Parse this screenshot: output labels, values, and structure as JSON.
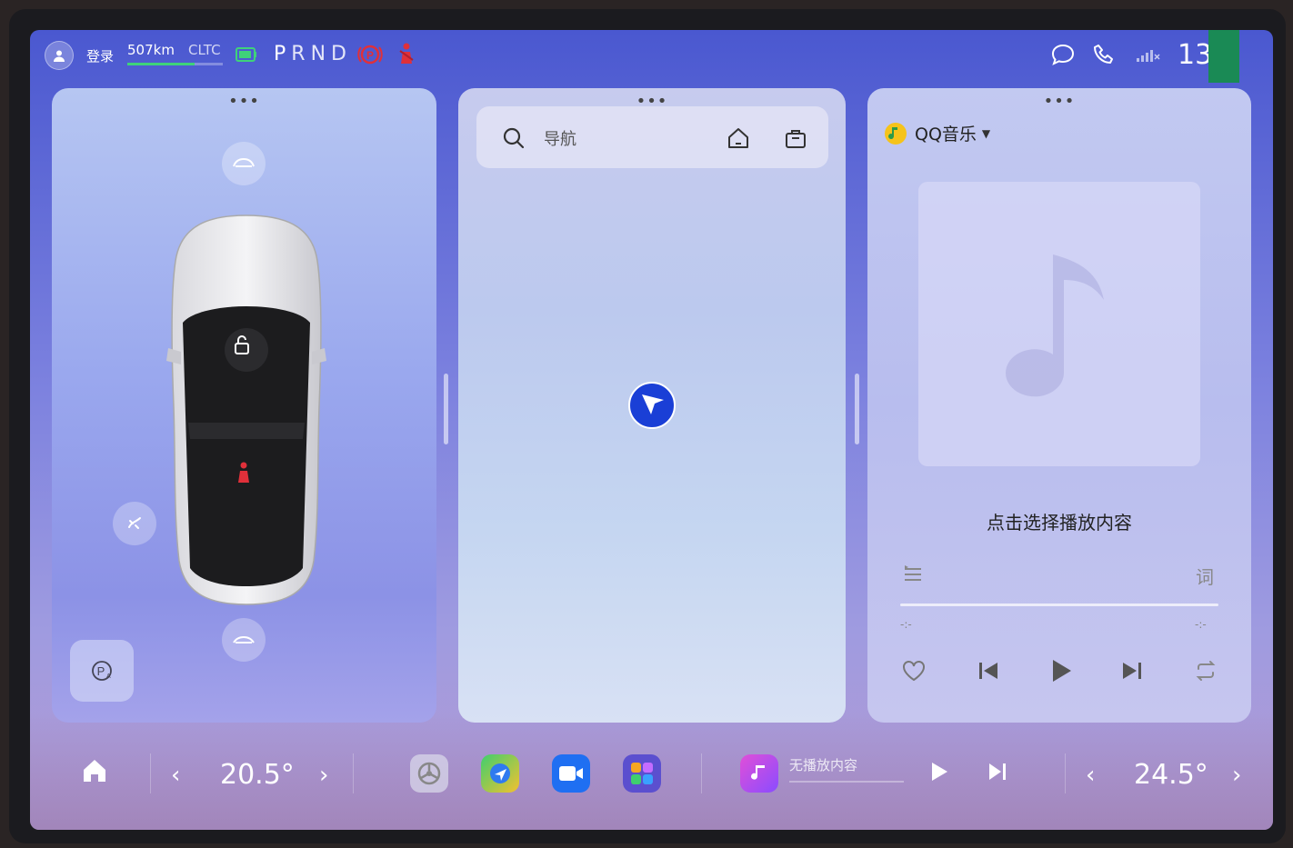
{
  "status": {
    "login_label": "登录",
    "range": "507km",
    "range_standard": "CLTC",
    "range_fraction": 0.7,
    "gears": [
      "P",
      "R",
      "N",
      "D"
    ],
    "clock": "13:57",
    "clock_visible": "13  7"
  },
  "left_card": {
    "menu": "•••"
  },
  "mid_card": {
    "menu": "•••",
    "search_label": "导航"
  },
  "right_card": {
    "menu": "•••",
    "app_name": "QQ音乐",
    "hint": "点击选择播放内容",
    "lyrics_button": "词",
    "time_start": "-:-",
    "time_end": "-:-",
    "progress_fraction": 0
  },
  "dock": {
    "left_temp": "20.5°",
    "right_temp": "24.5°",
    "media_status": "无播放内容"
  },
  "colors": {
    "range_bar": "#3fd27a",
    "alert_red": "#e0303a",
    "nav_blue": "#1a3fd6"
  }
}
